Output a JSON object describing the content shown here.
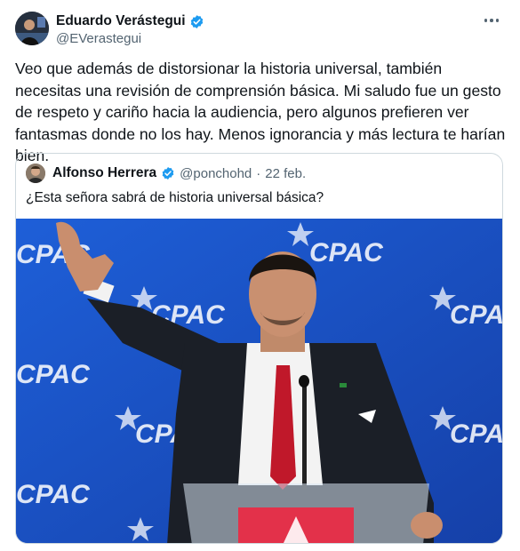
{
  "tweet": {
    "author": {
      "display_name": "Eduardo Verástegui",
      "handle": "@EVerastegui",
      "verified": true
    },
    "text": "Veo que además de distorsionar la historia universal, también necesitas una revisión de comprensión básica. Mi saludo fue un gesto de respeto y cariño hacia la audiencia, pero algunos prefieren ver fantasmas donde no los hay. Menos ignorancia y más lectura te harían bien.",
    "more_icon": "more-horizontal-icon"
  },
  "quoted": {
    "author": {
      "display_name": "Alfonso Herrera",
      "handle": "@ponchohd",
      "verified": true
    },
    "separator": "·",
    "date": "22 feb.",
    "text": "¿Esta señora sabrá de historia universal básica?",
    "media": {
      "description_icon": "photo",
      "backdrop_text": "CPAC"
    }
  },
  "colors": {
    "verified_blue": "#1d9bf0",
    "secondary_text": "#536471",
    "border": "#cfd9de",
    "stage_blue": "#1a4fc9"
  }
}
